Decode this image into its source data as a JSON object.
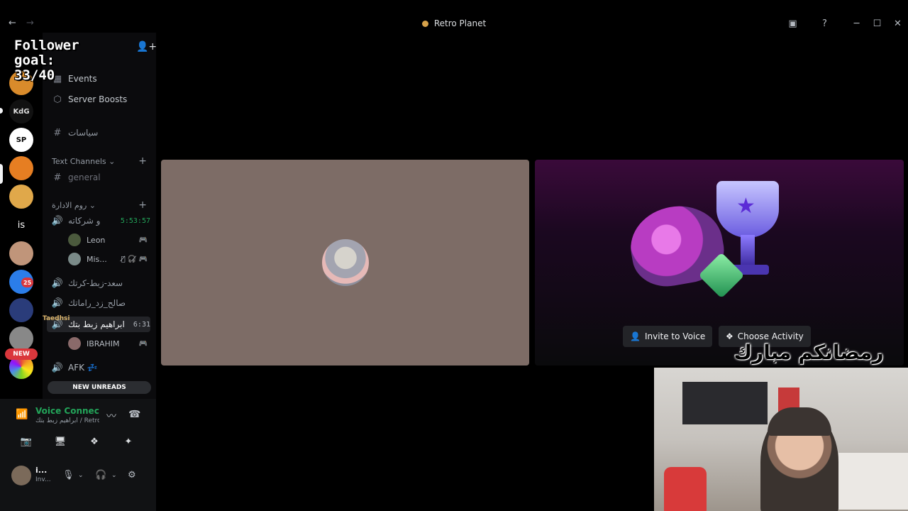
{
  "window": {
    "title": "Retro Planet",
    "back": "←",
    "forward": "→"
  },
  "overlay": {
    "goal_text": "Follower\ngoal:\n33/40"
  },
  "guilds": [
    {
      "label": "",
      "color": "#f5a623"
    },
    {
      "label": "KdG",
      "color": "#111"
    },
    {
      "label": "SP",
      "color": "#fff"
    },
    {
      "label": "",
      "color": "#e67e22"
    },
    {
      "label": "",
      "color": "#e0a84a"
    },
    {
      "label": "is",
      "color": "#1e1f22"
    },
    {
      "label": "",
      "color": "#c0957a"
    },
    {
      "label": "",
      "color": "#2b7de9"
    },
    {
      "label": "",
      "color": "#2a3c7a"
    },
    {
      "label": "",
      "color": "#888"
    },
    {
      "label": "",
      "color": "#e8483a"
    }
  ],
  "guild_badges": {
    "count": "25",
    "new": "NEW"
  },
  "sidebar": {
    "server_name": "Retro Planet",
    "events": "Events",
    "server_boosts": "Server Boosts",
    "rules_channel": "سياسات",
    "text_category": "Text Channels",
    "general": "general",
    "admin_category": "روم الادارة",
    "voice1": "و شركاته",
    "voice1_time": "5:53:57",
    "voice1_users": [
      {
        "name": "Leon"
      },
      {
        "name": "Mis..."
      }
    ],
    "voice2": "سعد-زبط-كرتك",
    "voice3": "صالح_زد_راماتك",
    "voice4": "ابراهيم زبط بتك",
    "voice4_time": "6:31",
    "voice4_users": [
      {
        "name": "IBRAHIM"
      }
    ],
    "afk": "AFK",
    "afk_emoji": "💤",
    "new_unreads": "NEW UNREADS",
    "overlay_name": "Taedhsi"
  },
  "voice_panel": {
    "status": "Voice Connected",
    "sub": "ابراهيم زبط بتك / Retro...",
    "user_name": "i...",
    "user_status": "Inv..."
  },
  "activity": {
    "invite_label": "Invite to Voice",
    "choose_label": "Choose Activity"
  },
  "stream_overlay": {
    "ramadan_text": "رمضانكم مبارك"
  }
}
